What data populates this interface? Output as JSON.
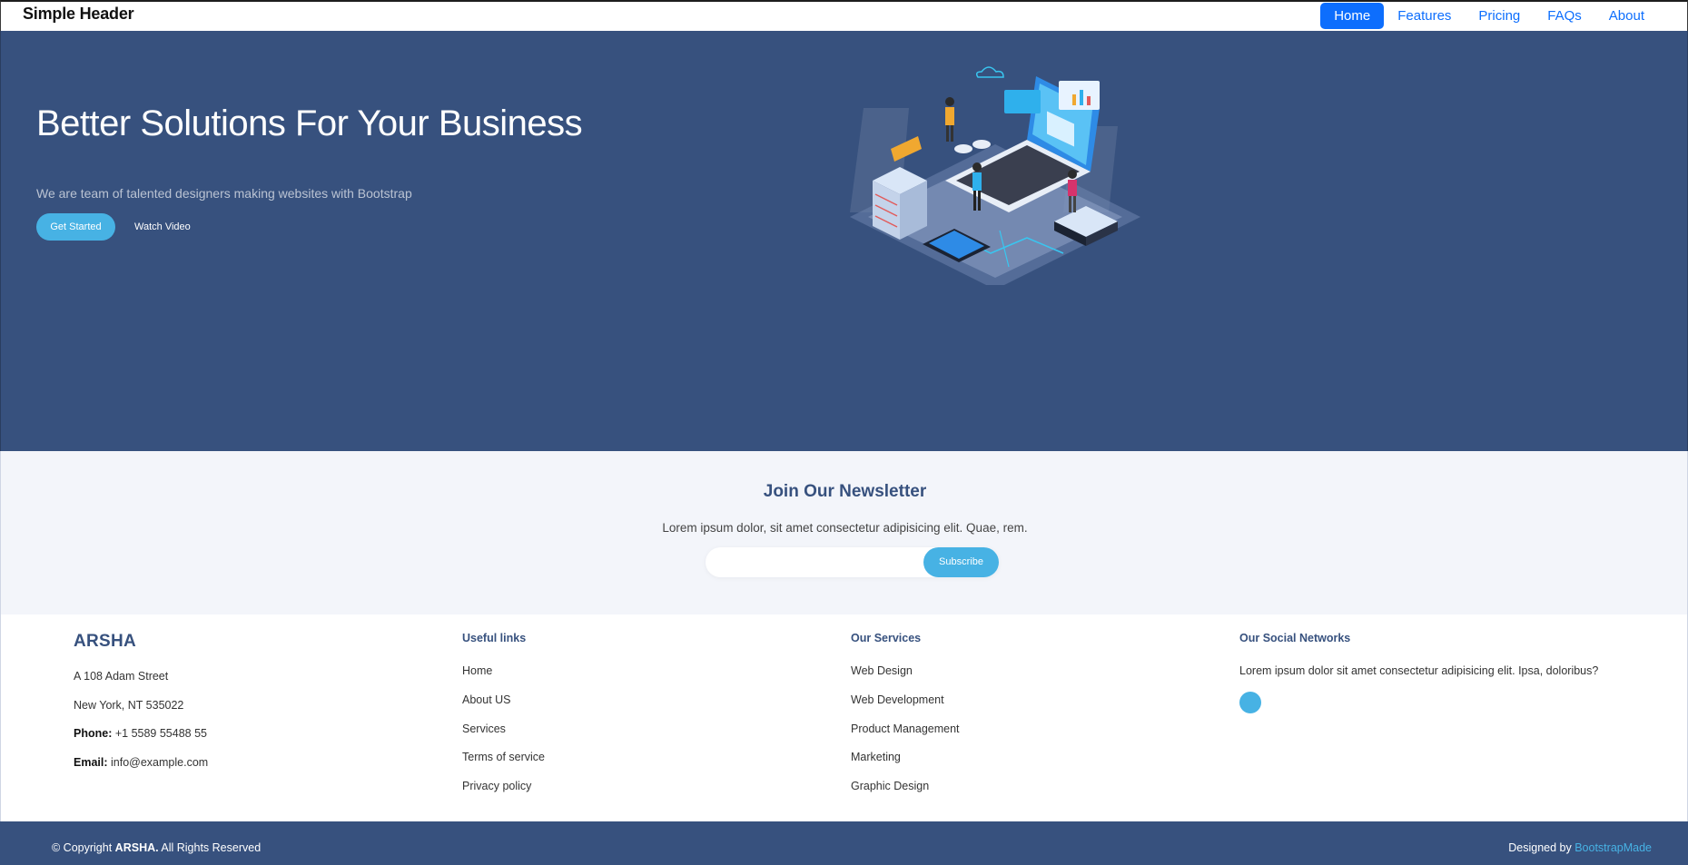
{
  "header": {
    "brand": "Simple Header",
    "nav": [
      "Home",
      "Features",
      "Pricing",
      "FAQs",
      "About"
    ],
    "active_nav": "Home"
  },
  "hero": {
    "title": "Better Solutions For Your Business",
    "subtitle": "We are team of talented designers making websites with Bootstrap",
    "get_started": "Get Started",
    "watch_video": "Watch Video"
  },
  "newsletter": {
    "title": "Join Our Newsletter",
    "text": "Lorem ipsum dolor, sit amet consectetur adipisicing elit. Quae, rem.",
    "input_value": "",
    "subscribe": "Subscribe"
  },
  "footer": {
    "brand": "ARSHA",
    "address1": "A 108 Adam Street",
    "address2": "New York, NT 535022",
    "phone_label": "Phone:",
    "phone": "+1 5589 55488 55",
    "email_label": "Email:",
    "email": "info@example.com",
    "useful_links_title": "Useful links",
    "useful_links": [
      "Home",
      "About US",
      "Services",
      "Terms of service",
      "Privacy policy"
    ],
    "services_title": "Our Services",
    "services": [
      "Web Design",
      "Web Development",
      "Product Management",
      "Marketing",
      "Graphic Design"
    ],
    "social_title": "Our Social Networks",
    "social_text": "Lorem ipsum dolor sit amet consectetur adipisicing elit. Ipsa, doloribus?"
  },
  "bottom": {
    "copyright_prefix": "© Copyright",
    "copyright_brand": "ARSHA.",
    "copyright_suffix": "All Rights Reserved",
    "designed_by": "Designed by",
    "designer": "BootstrapMade"
  },
  "colors": {
    "primary_dark": "#37517e",
    "accent": "#47b2e4",
    "nav_blue": "#0d6efd",
    "newsletter_bg": "#f3f5fa"
  }
}
